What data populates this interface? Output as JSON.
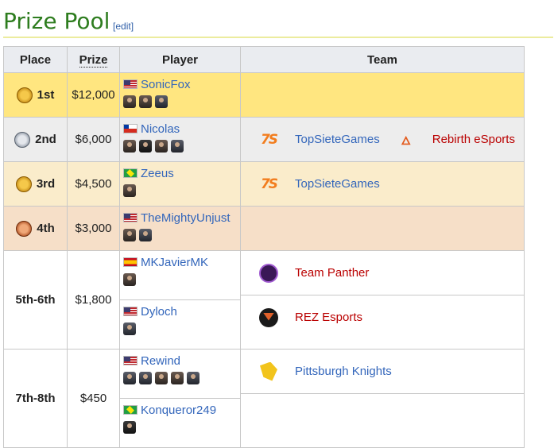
{
  "header": {
    "title": "Prize Pool",
    "edit_label": "[edit]",
    "edit_link": "edit"
  },
  "table": {
    "columns": {
      "place": "Place",
      "prize": "Prize",
      "player": "Player",
      "team": "Team"
    },
    "rows": [
      {
        "place": "1st",
        "medal": "gold",
        "prize": "$12,000",
        "players": [
          {
            "flag": "us",
            "name": "SonicFox"
          }
        ],
        "teams": []
      },
      {
        "place": "2nd",
        "medal": "silver",
        "prize": "$6,000",
        "players": [
          {
            "flag": "cl",
            "name": "Nicolas"
          }
        ],
        "teams": [
          {
            "name": "TopSieteGames"
          },
          {
            "name": "Rebirth eSports"
          }
        ]
      },
      {
        "place": "3rd",
        "medal": "gold",
        "prize": "$4,500",
        "players": [
          {
            "flag": "br",
            "name": "Zeeus"
          }
        ],
        "teams": [
          {
            "name": "TopSieteGames"
          }
        ]
      },
      {
        "place": "4th",
        "medal": "bronze",
        "prize": "$3,000",
        "players": [
          {
            "flag": "us",
            "name": "TheMightyUnjust"
          }
        ],
        "teams": []
      },
      {
        "place": "5th-6th",
        "prize": "$1,800",
        "players": [
          {
            "flag": "es",
            "name": "MKJavierMK"
          },
          {
            "flag": "us",
            "name": "Dyloch"
          }
        ],
        "teams": [
          {
            "name": "Team Panther"
          },
          {
            "name": "REZ Esports"
          }
        ]
      },
      {
        "place": "7th-8th",
        "prize": "$450",
        "players": [
          {
            "flag": "us",
            "name": "Rewind"
          },
          {
            "flag": "br",
            "name": "Konqueror249"
          }
        ],
        "teams": [
          {
            "name": "Pittsburgh Knights"
          }
        ]
      }
    ]
  },
  "logos": {
    "tsg": "7S",
    "reb": "🜂"
  },
  "colors": {
    "title": "#2e7d1f",
    "link": "#3366bb",
    "redlink": "#ba0000",
    "gold_row": "#ffe680",
    "silver_row": "#ededed",
    "bronze3_row": "#faeccb",
    "bronze4_row": "#f6dfc8",
    "header_bg": "#eaecf0"
  }
}
